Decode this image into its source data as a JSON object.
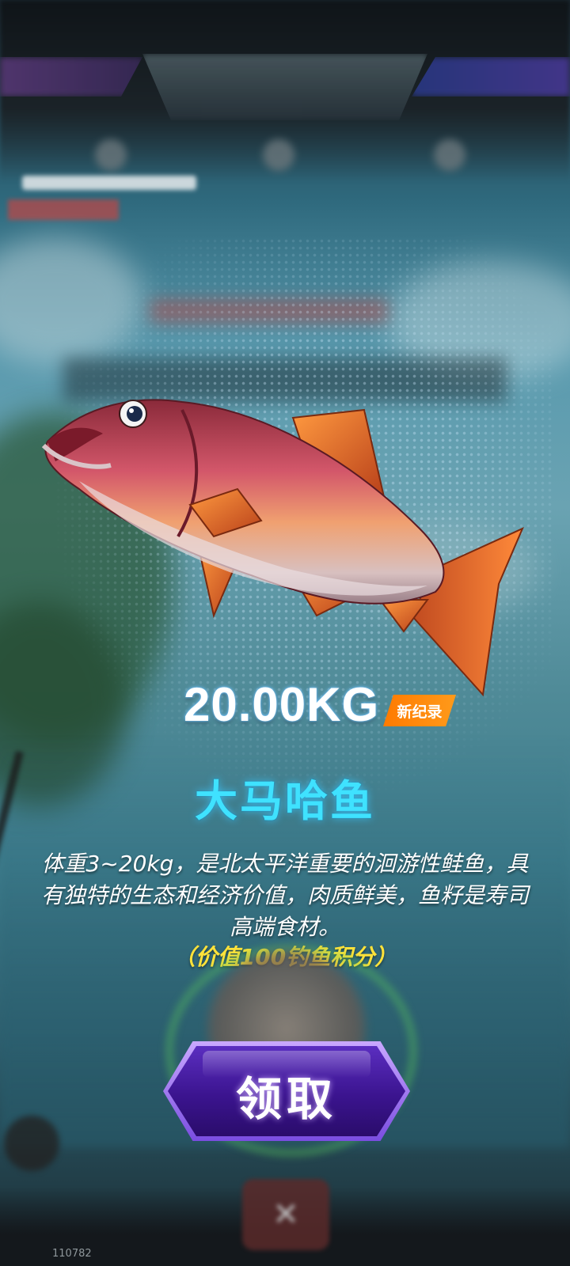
{
  "result": {
    "weight": "20.00KG",
    "record_badge": "新纪录",
    "fish_name": "大马哈鱼",
    "description": "体重3~20kg，是北太平洋重要的洄游性鲑鱼，具有独特的生态和经济价值，肉质鲜美，鱼籽是寿司高端食材。",
    "value_text": "（价值100钓鱼积分）"
  },
  "actions": {
    "claim_label": "领取"
  },
  "footer": {
    "build_id": "110782"
  },
  "icons": {
    "close": "close-icon",
    "fish": "fish-illustration"
  },
  "colors": {
    "fish_name": "#3fe2ff",
    "value_text": "#ffe23a",
    "record_badge": "#ff8a00",
    "claim_button": "#4a1fb0"
  }
}
